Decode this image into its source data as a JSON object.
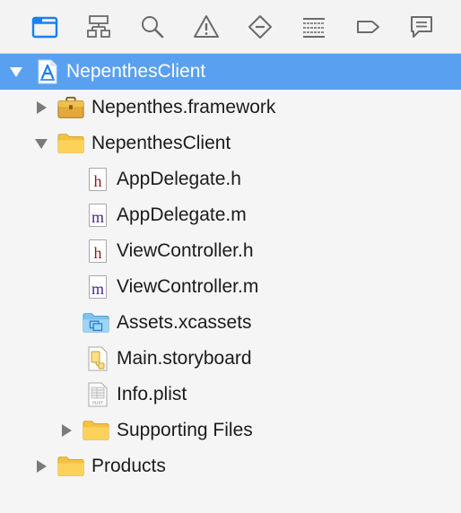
{
  "toolbar": {
    "tabs": [
      {
        "icon": "folder-icon",
        "active": true
      },
      {
        "icon": "hierarchy-icon",
        "active": false
      },
      {
        "icon": "search-icon",
        "active": false
      },
      {
        "icon": "warning-icon",
        "active": false
      },
      {
        "icon": "diamond-minus-icon",
        "active": false
      },
      {
        "icon": "list-icon",
        "active": false
      },
      {
        "icon": "tag-icon",
        "active": false
      },
      {
        "icon": "chat-bubble-icon",
        "active": false
      }
    ],
    "active_color": "#1a7ff0",
    "inactive_color": "#6b6b6b"
  },
  "tree": {
    "items": [
      {
        "label": "NepenthesClient",
        "icon": "project-icon",
        "expanded": true,
        "selected": true
      },
      {
        "label": "Nepenthes.framework",
        "icon": "framework-icon",
        "expanded": false
      },
      {
        "label": "NepenthesClient",
        "icon": "folder-icon",
        "expanded": true
      },
      {
        "label": "AppDelegate.h",
        "icon": "header-file-icon",
        "glyph": "h"
      },
      {
        "label": "AppDelegate.m",
        "icon": "objc-file-icon",
        "glyph": "m"
      },
      {
        "label": "ViewController.h",
        "icon": "header-file-icon",
        "glyph": "h"
      },
      {
        "label": "ViewController.m",
        "icon": "objc-file-icon",
        "glyph": "m"
      },
      {
        "label": "Assets.xcassets",
        "icon": "asset-catalog-icon"
      },
      {
        "label": "Main.storyboard",
        "icon": "storyboard-icon"
      },
      {
        "label": "Info.plist",
        "icon": "plist-icon",
        "glyph": "PLIST"
      },
      {
        "label": "Supporting Files",
        "icon": "folder-icon",
        "expanded": false
      },
      {
        "label": "Products",
        "icon": "folder-icon",
        "expanded": false
      }
    ],
    "selected_color": "#5aa0f0",
    "header_glyph_color": "#8b1a1a",
    "impl_glyph_color": "#4b2a82"
  }
}
